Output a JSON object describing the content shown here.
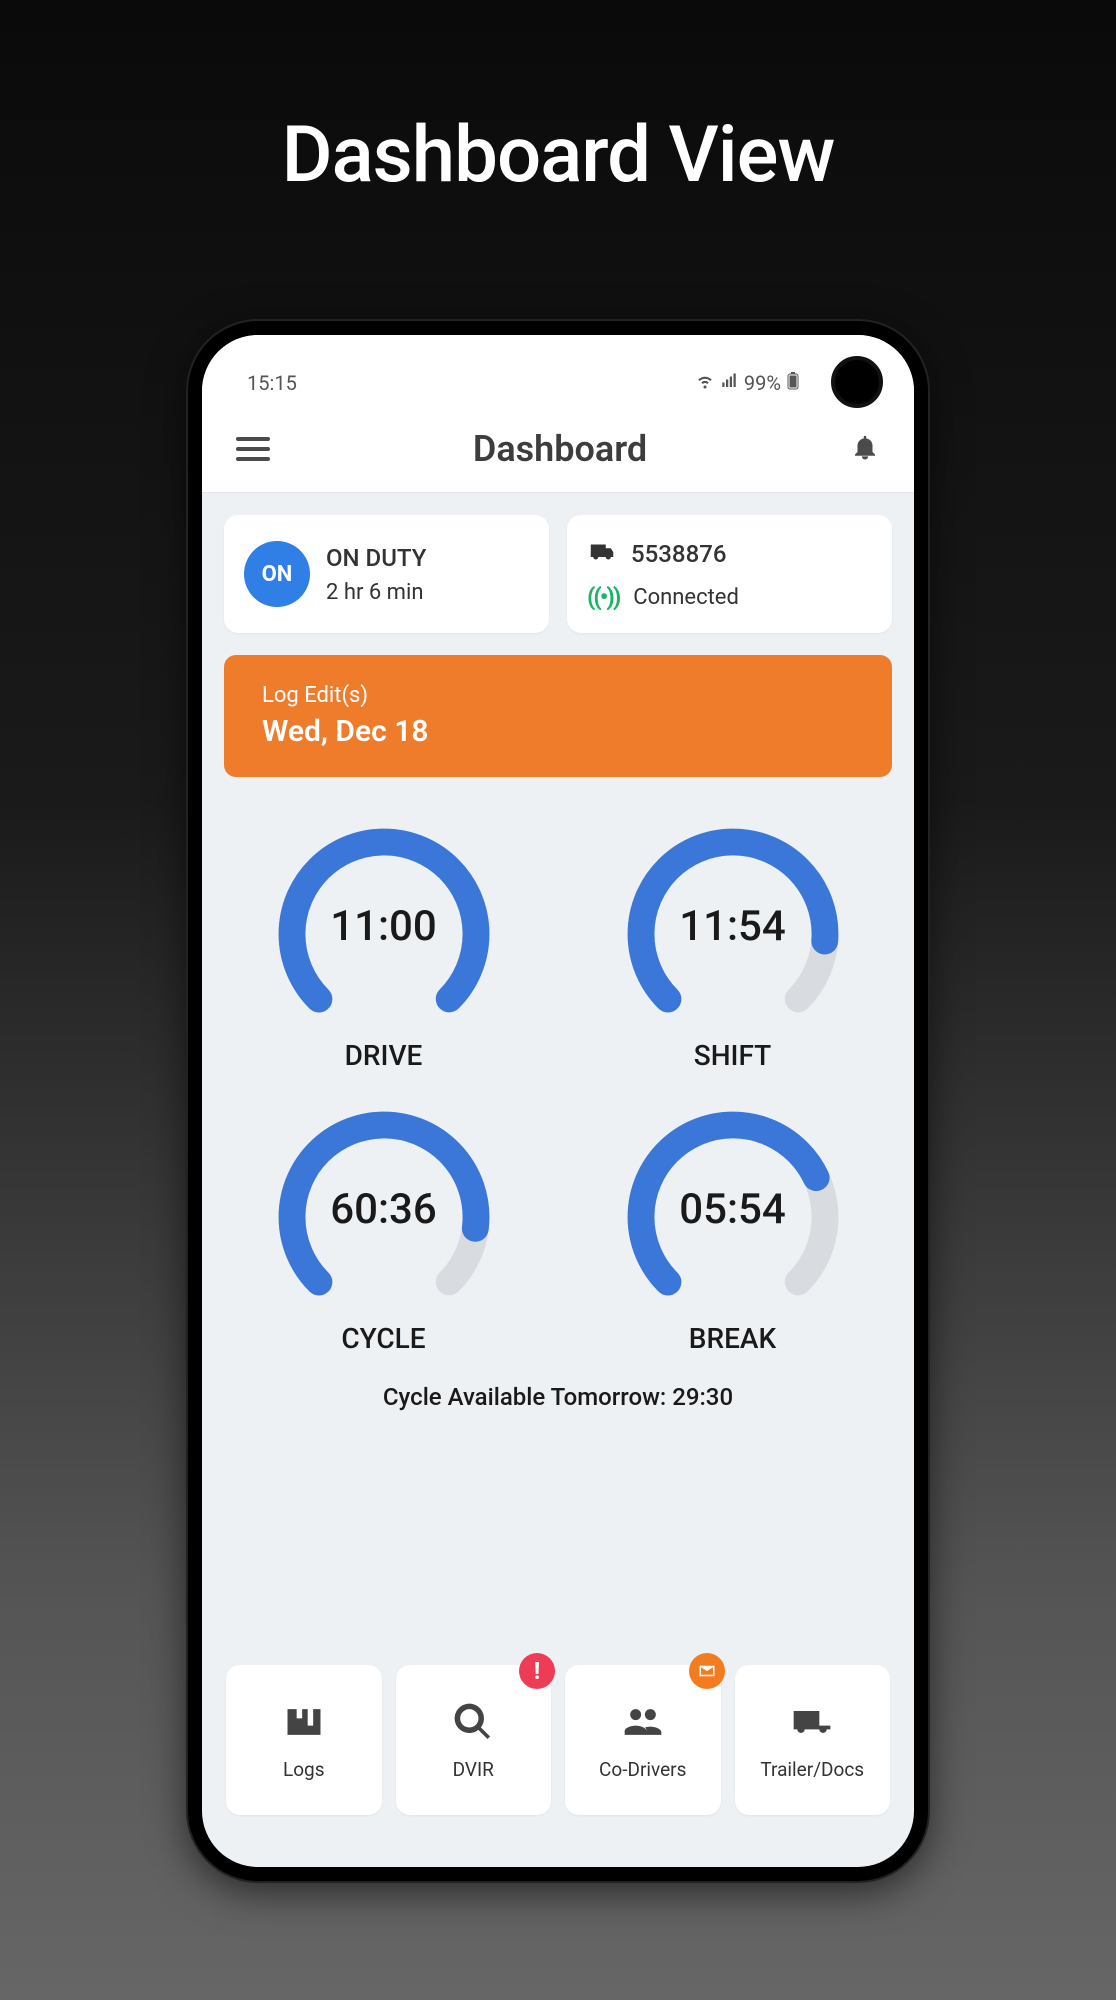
{
  "promo_title": "Dashboard View",
  "statusbar": {
    "time": "15:15",
    "battery": "99%"
  },
  "header": {
    "title": "Dashboard"
  },
  "duty_card": {
    "badge": "ON",
    "status": "ON DUTY",
    "duration": "2 hr 6 min"
  },
  "vehicle_card": {
    "id": "5538876",
    "status": "Connected"
  },
  "banner": {
    "label": "Log Edit(s)",
    "date": "Wed, Dec 18"
  },
  "gauges": {
    "drive": {
      "time": "11:00",
      "label": "DRIVE",
      "pct": 100
    },
    "shift": {
      "time": "11:54",
      "label": "SHIFT",
      "pct": 85
    },
    "cycle": {
      "time": "60:36",
      "label": "CYCLE",
      "pct": 86
    },
    "break": {
      "time": "05:54",
      "label": "BREAK",
      "pct": 74
    }
  },
  "cycle_note": "Cycle Available Tomorrow: 29:30",
  "tiles": {
    "logs": "Logs",
    "dvir": "DVIR",
    "codrivers": "Co-Drivers",
    "trailer": "Trailer/Docs",
    "dvir_badge": "!",
    "codrivers_badge_icon": "mail"
  },
  "colors": {
    "blue": "#3a77d8",
    "track": "#d8dbe0",
    "orange": "#ee7c2b",
    "green": "#1ab566"
  }
}
